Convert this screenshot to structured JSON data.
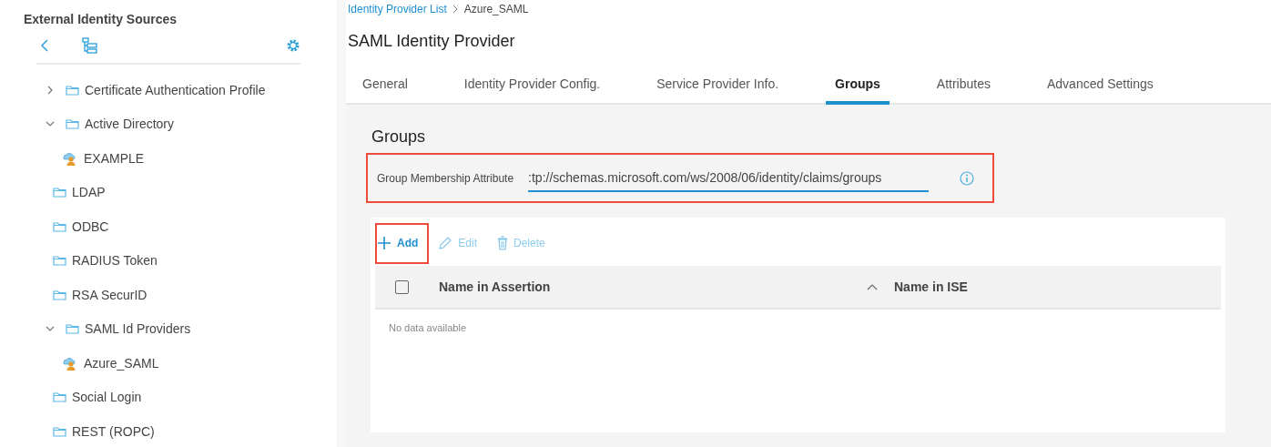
{
  "sidebar": {
    "title": "External Identity Sources",
    "tree": [
      {
        "label": "Certificate Authentication Profile",
        "kind": "folder",
        "expanded": false
      },
      {
        "label": "Active Directory",
        "kind": "folder",
        "expanded": true,
        "children": [
          {
            "label": "EXAMPLE",
            "kind": "provider"
          }
        ]
      },
      {
        "label": "LDAP",
        "kind": "folder"
      },
      {
        "label": "ODBC",
        "kind": "folder"
      },
      {
        "label": "RADIUS Token",
        "kind": "folder"
      },
      {
        "label": "RSA SecurID",
        "kind": "folder"
      },
      {
        "label": "SAML Id Providers",
        "kind": "folder",
        "expanded": true,
        "children": [
          {
            "label": "Azure_SAML",
            "kind": "provider"
          }
        ]
      },
      {
        "label": "Social Login",
        "kind": "folder"
      },
      {
        "label": "REST (ROPC)",
        "kind": "folder"
      }
    ]
  },
  "breadcrumb": [
    {
      "label": "Identity Provider List",
      "kind": "link"
    },
    {
      "label": "Azure_SAML",
      "kind": "current"
    }
  ],
  "page_title": "SAML Identity Provider",
  "tabs": [
    {
      "label": "General",
      "selected": false
    },
    {
      "label": "Identity Provider Config.",
      "selected": false
    },
    {
      "label": "Service Provider Info.",
      "selected": false
    },
    {
      "label": "Groups",
      "selected": true
    },
    {
      "label": "Attributes",
      "selected": false
    },
    {
      "label": "Advanced Settings",
      "selected": false
    }
  ],
  "section_title": "Groups",
  "membership_field": {
    "label": "Group Membership Attribute",
    "value": ":tp://schemas.microsoft.com/ws/2008/06/identity/claims/groups",
    "highlighted": true
  },
  "toolbar": [
    {
      "label": "Add",
      "kind": "add",
      "disabled": false,
      "highlighted": true
    },
    {
      "label": "Edit",
      "kind": "edit",
      "disabled": true,
      "highlighted": false
    },
    {
      "label": "Delete",
      "kind": "delete",
      "disabled": true,
      "highlighted": false
    }
  ],
  "table": {
    "select_all_checked": false,
    "columns": [
      {
        "label": "Name in Assertion",
        "sort_icon": false
      },
      {
        "label": "Name in ISE",
        "sort_icon": true
      }
    ],
    "empty_text": "No data available"
  }
}
